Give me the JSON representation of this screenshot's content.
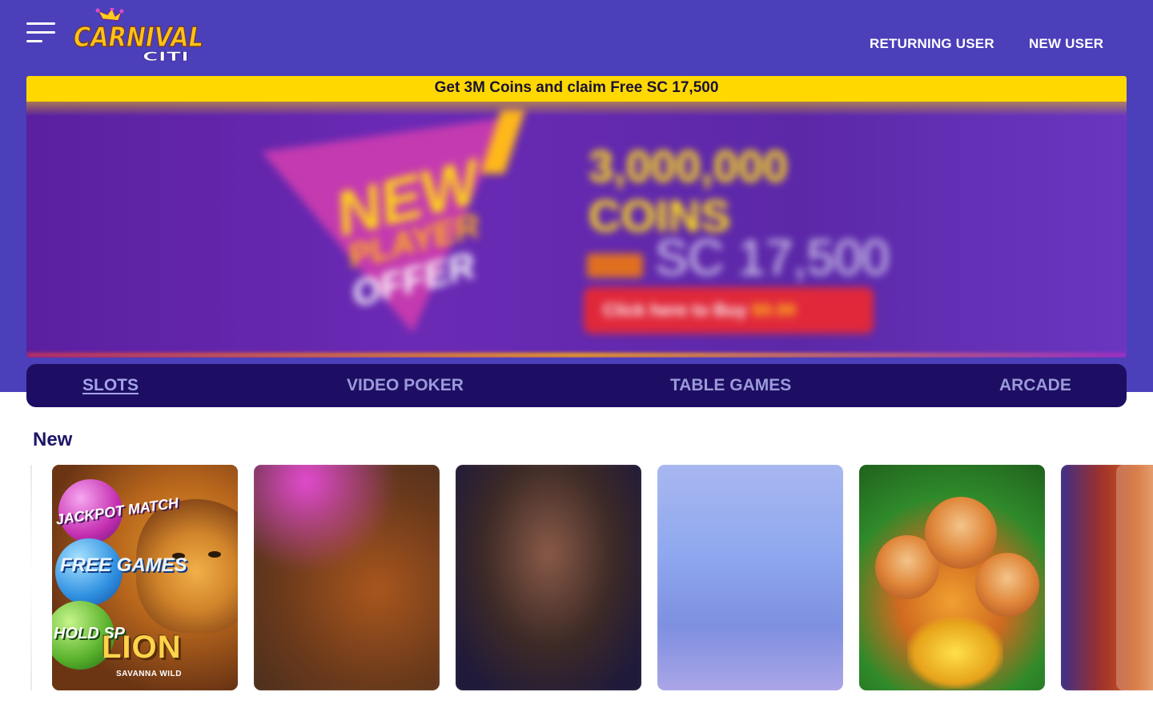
{
  "header": {
    "logo_text": "CARNIVAL",
    "logo_subtext": "CITI",
    "returning_user_label": "RETURNING USER",
    "new_user_label": "NEW USER"
  },
  "promo": {
    "strip_text": "Get 3M Coins and claim Free SC 17,500"
  },
  "categories": {
    "tabs": [
      {
        "label": "SLOTS",
        "active": true
      },
      {
        "label": "VIDEO POKER",
        "active": false
      },
      {
        "label": "TABLE GAMES",
        "active": false
      },
      {
        "label": "ARCADE",
        "active": false
      }
    ]
  },
  "section": {
    "title": "New"
  },
  "tiles": [
    {
      "words": [
        "JACKPOT MATCH",
        "FREE GAMES",
        "HOLD SP",
        "LION",
        "SAVANNA WILD"
      ]
    }
  ],
  "colors": {
    "header_bg": "#4b3fba",
    "promo_strip": "#ffd800",
    "category_bar": "#1d0e63",
    "section_title": "#1c1568"
  },
  "icons": [
    "hamburger-menu-icon",
    "carnival-citi-logo"
  ]
}
